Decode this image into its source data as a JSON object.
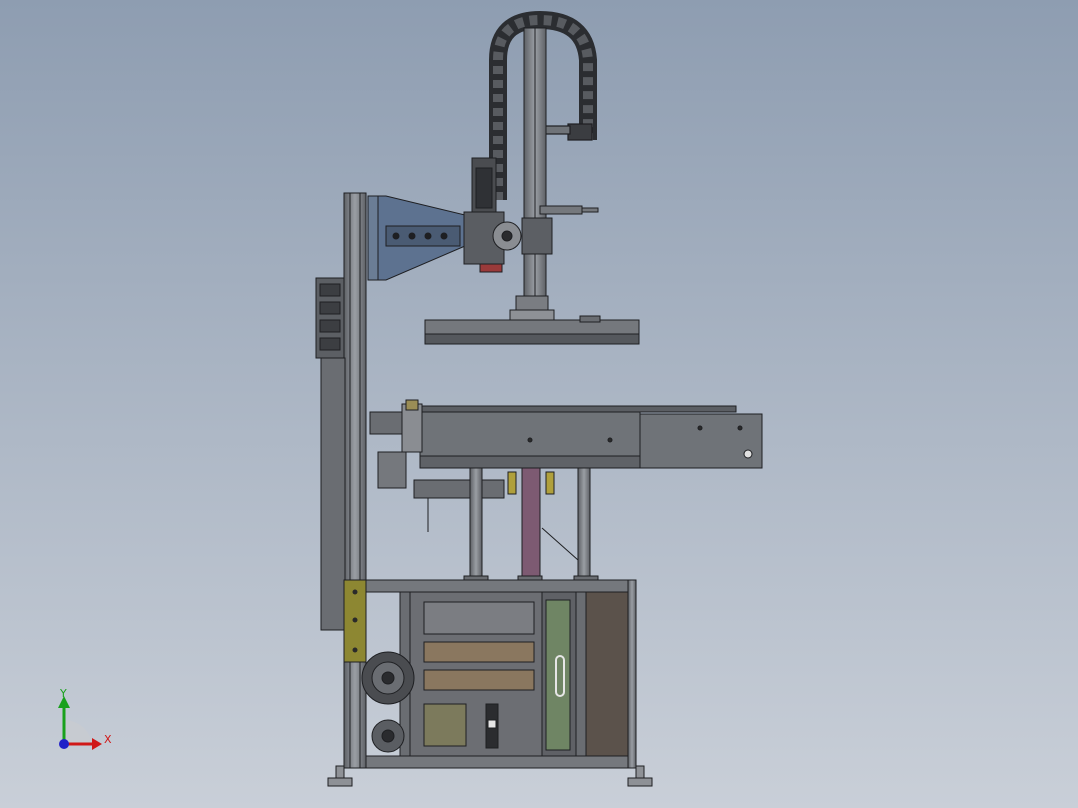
{
  "colors": {
    "background_top": "#8e9db1",
    "background_bottom": "#c9cfd8",
    "frame": "#6f7378",
    "edge": "#1e1f22",
    "blue_bracket": "#5d7290",
    "yellow_plate": "#8d8732",
    "cabinet_panel": "#6c6e73",
    "brown_panel": "#8a775f",
    "olive_panel": "#7c7a5c",
    "green_panel": "#6f8564",
    "purple_rod": "#7d5a72",
    "x_axis": "#d01818",
    "y_axis": "#19a11c",
    "z_axis": "#2020c8"
  },
  "icons": {
    "model": "machine-assembly-model",
    "triad": "coordinate-triad-icon"
  },
  "triad": {
    "x_label": "X",
    "y_label": "Y"
  }
}
